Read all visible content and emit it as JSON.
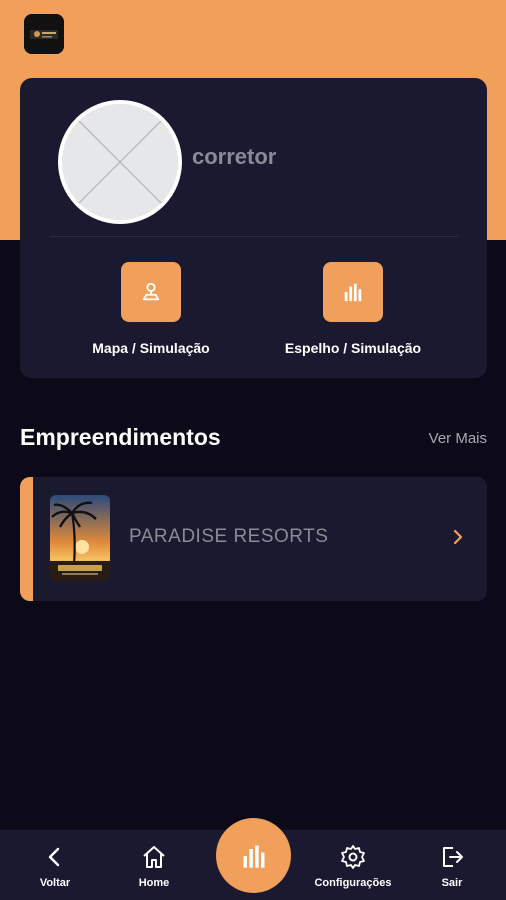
{
  "header": {
    "logo_icon": "paradise-app-logo"
  },
  "profile": {
    "username": "corretor",
    "avatar_icon": "placeholder-image-icon"
  },
  "actions": [
    {
      "label": "Mapa / Simulação",
      "icon": "map-pin-icon"
    },
    {
      "label": "Espelho / Simulação",
      "icon": "bar-chart-icon"
    }
  ],
  "section": {
    "title": "Empreendimentos",
    "see_more": "Ver Mais"
  },
  "projects": [
    {
      "name": "PARADISE RESORTS",
      "thumb_icon": "paradise-resorts-thumbnail",
      "chevron_icon": "chevron-right-icon"
    }
  ],
  "bottom_nav": {
    "voltar": "Voltar",
    "home": "Home",
    "center_icon": "bar-chart-icon",
    "configuracoes": "Configurações",
    "sair": "Sair"
  },
  "colors": {
    "accent": "#f0a05a",
    "card_bg": "#1b1930",
    "page_bg": "#0c0a18"
  }
}
